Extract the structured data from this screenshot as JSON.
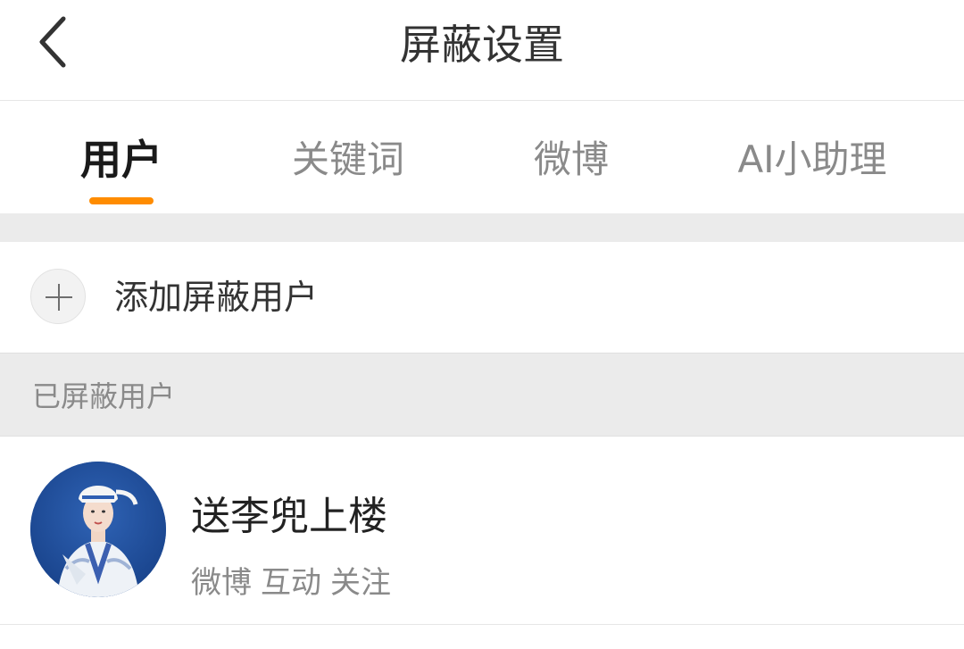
{
  "header": {
    "title": "屏蔽设置",
    "back_icon": "chevron-left-icon"
  },
  "tabs": [
    {
      "label": "用户",
      "active": true
    },
    {
      "label": "关键词",
      "active": false
    },
    {
      "label": "微博",
      "active": false
    },
    {
      "label": "AI小助理",
      "active": false
    }
  ],
  "add_user": {
    "icon": "plus-icon",
    "label": "添加屏蔽用户"
  },
  "section": {
    "title": "已屏蔽用户"
  },
  "blocked_users": [
    {
      "name": "送李兜上楼",
      "tags": [
        "微博",
        "互动",
        "关注"
      ]
    }
  ],
  "colors": {
    "accent": "#ff8c00",
    "background_gray": "#ebebeb",
    "text_primary": "#333333",
    "text_secondary": "#8a8a8a"
  }
}
